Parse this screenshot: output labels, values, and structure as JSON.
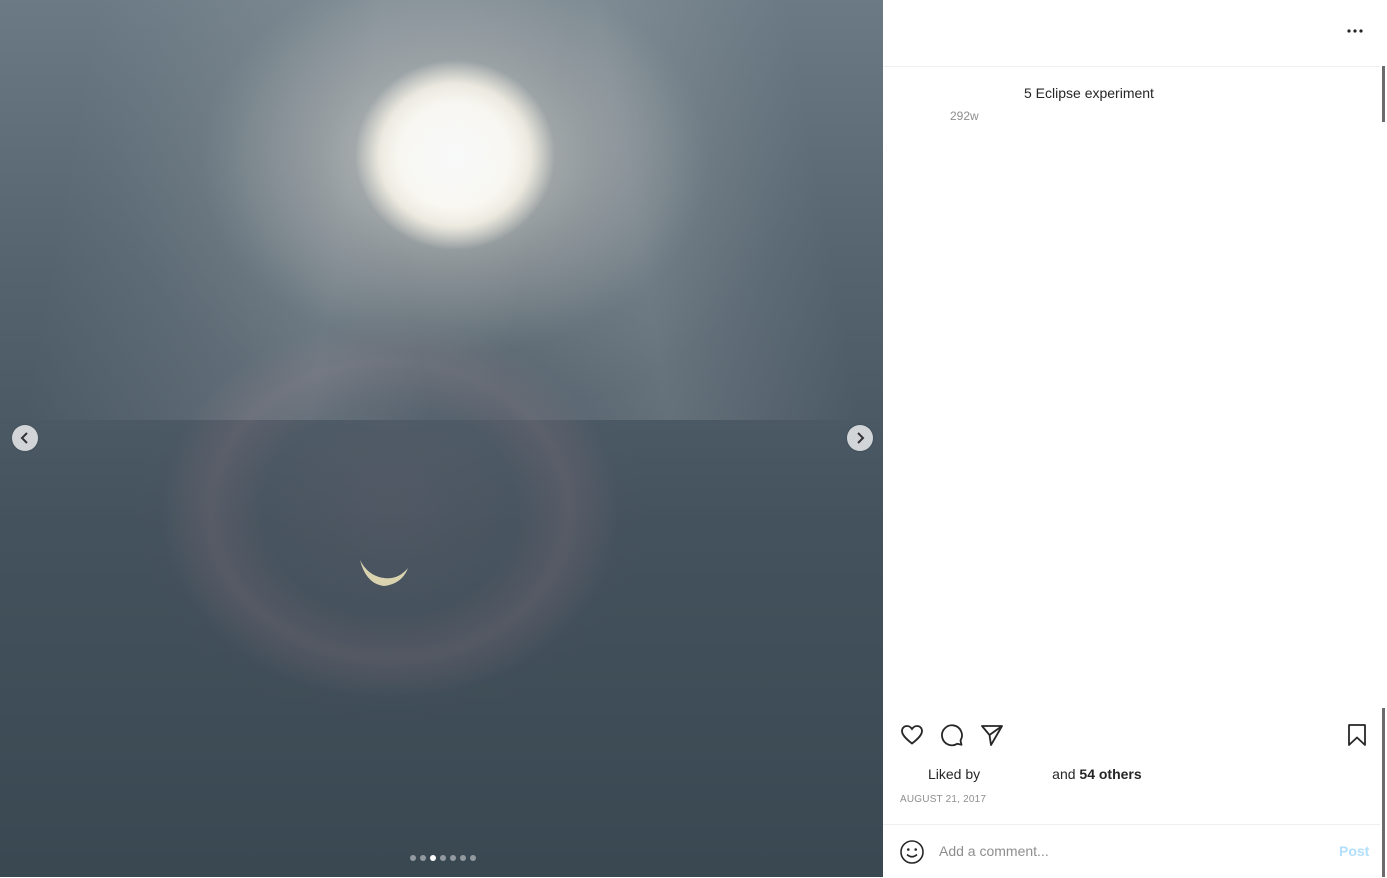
{
  "carousel": {
    "slide_count": 7,
    "active_index": 2
  },
  "post": {
    "caption": "5 Eclipse experiment",
    "age": "292w",
    "liked_prefix": "Liked by",
    "liked_mid": "and",
    "liked_others": "54 others",
    "date": "AUGUST 21, 2017"
  },
  "comment": {
    "placeholder": "Add a comment...",
    "post_label": "Post"
  },
  "icons": {
    "prev": "chevron-left-icon",
    "next": "chevron-right-icon",
    "more": "more-horizontal-icon",
    "like": "heart-icon",
    "comment": "comment-bubble-icon",
    "share": "paper-plane-icon",
    "save": "bookmark-icon",
    "emoji": "smiley-icon"
  },
  "colors": {
    "post_button": "#b2dffc",
    "muted_text": "#8e8e8e"
  }
}
